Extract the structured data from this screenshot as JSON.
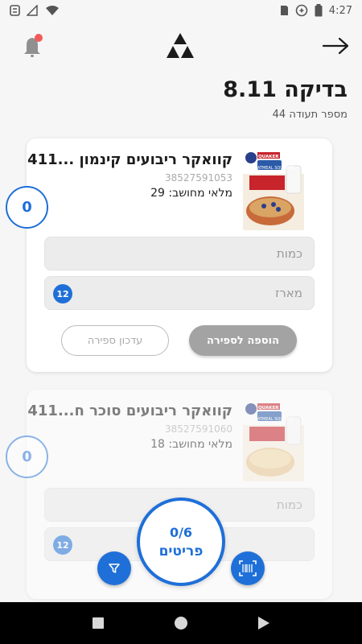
{
  "status_bar": {
    "time": "4:27"
  },
  "header": {
    "title": "בדיקה 8.11",
    "subtitle": "מספר תעודה 44"
  },
  "colors": {
    "accent": "#1f6fd8",
    "notification": "#f25a5a"
  },
  "products": [
    {
      "name": "קוואקר ריבועים קינמון ...411",
      "code": "38527591053",
      "stock_label": "מלאי מחושב: 29",
      "count": "0",
      "quantity_placeholder": "כמות",
      "package_placeholder": "מארז",
      "package_badge": "12",
      "add_button": "הוספה לספירה",
      "update_button": "עדכון ספירה",
      "image_brand": "QUAKER",
      "image_text": "OATMEAL SQUARES"
    },
    {
      "name": "קוואקר ריבועים סוכר ח...411",
      "code": "38527591060",
      "stock_label": "מלאי מחושב: 18",
      "count": "0",
      "quantity_placeholder": "כמות",
      "package_badge": "12",
      "image_brand": "QUAKER",
      "image_text": "OATMEAL SQUARES"
    }
  ],
  "progress": {
    "count": "0/6",
    "label": "פריטים"
  }
}
